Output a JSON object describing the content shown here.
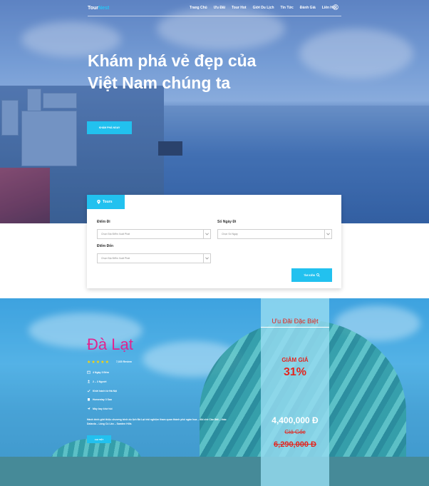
{
  "nav": {
    "logo_main": "Tour",
    "logo_accent": "Nest",
    "links": [
      "Trang Chủ",
      "Ưu Đãi",
      "Tour Hot",
      "Giới Du Lịch",
      "Tin Tức",
      "Đánh Giá",
      "Liên Hệ"
    ]
  },
  "hero": {
    "title": "Khám phá vẻ đẹp của Việt Nam chúng ta",
    "button_label": "KHÁM PHÁ NGAY"
  },
  "search": {
    "tab_label": "Tours",
    "departure_label": "Điểm Đi",
    "departure_placeholder": "Chọn Địa Điểm Xuất Phát",
    "days_label": "Số Ngày Đi",
    "days_placeholder": "Chọn Số Ngày",
    "destination_label": "Điểm Đến",
    "destination_placeholder": "Chọn Địa Điểm Xuất Phát",
    "search_button": "TÌM KIẾM"
  },
  "promo": {
    "city": "Đà Lạt",
    "rating": 5,
    "reviews": "7,020 Review",
    "info": [
      "4 Ngày 3 Đêm",
      "2 – 3 Người",
      "Khởi hành từ Hà Nội",
      "Homestay 3 Sao",
      "Máy bay khứ hồi"
    ],
    "description": "Hành trình giới thiệu chương trình du lịch Đà Lạt trải nghiệm tham quan thành phố ngàn hoa – đồi chè Cầu Đất – thác Datanla – Làng Cù Lần – Samten Hills",
    "detail_button": "CHI TIẾT",
    "offer_title": "Ưu Đãi Đặc Biệt",
    "discount_label": "GIẢM GIÁ",
    "discount_value": "31%",
    "new_price": "4,400,000 Đ",
    "old_label": "Giá Gốc",
    "old_price": "6,290,000 Đ"
  },
  "colors": {
    "accent": "#22c1ef",
    "city_name": "#e2238f",
    "offer_red": "#e3261f",
    "stars": "#ffd400"
  }
}
